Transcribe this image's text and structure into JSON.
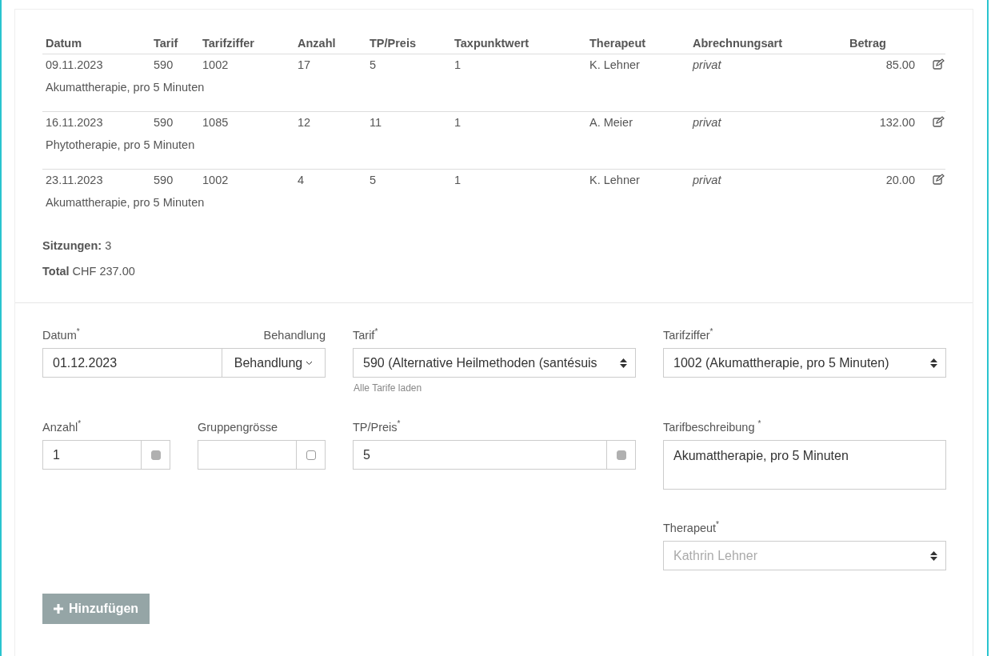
{
  "table": {
    "columns": [
      "Datum",
      "Tarif",
      "Tarifziffer",
      "Anzahl",
      "TP/Preis",
      "Taxpunktwert",
      "Therapeut",
      "Abrechnungsart",
      "Betrag"
    ],
    "rows": [
      {
        "cells": [
          "09.11.2023",
          "590",
          "1002",
          "17",
          "5",
          "1",
          "K. Lehner",
          "privat",
          "85.00"
        ],
        "description": "Akumattherapie, pro 5 Minuten"
      },
      {
        "cells": [
          "16.11.2023",
          "590",
          "1085",
          "12",
          "11",
          "1",
          "A. Meier",
          "privat",
          "132.00"
        ],
        "description": "Phytotherapie, pro 5 Minuten"
      },
      {
        "cells": [
          "23.11.2023",
          "590",
          "1002",
          "4",
          "5",
          "1",
          "K. Lehner",
          "privat",
          "20.00"
        ],
        "description": "Akumattherapie, pro 5 Minuten"
      }
    ]
  },
  "summary": [
    "**Sitzungen:** 3",
    "**Total** CHF 237.00"
  ],
  "form": {
    "datum": {
      "label": "Datum$^{*}$",
      "side_label": "Behandlung",
      "value": "01.12.2023",
      "dropdown": "Behandlung"
    },
    "tarif": {
      "label": "Tarif$^{*}$",
      "value": "590 (Alternative Heilmethoden (santésuis",
      "hint": "Alle Tarife laden"
    },
    "tarifziffer": {
      "label": "Tarifziffer$^{*}$",
      "value": "1002 (Akumattherapie, pro 5 Minuten)"
    },
    "anzahl": {
      "label": "Anzahl$^{*}$",
      "value": "1",
      "checked": true
    },
    "gruppengroesse": {
      "label": "Gruppengrösse",
      "checked": false
    },
    "tp_preis": {
      "label": "TP/Preis$^{*}$",
      "value": "5",
      "checked": true
    },
    "tarifbeschreibung": {
      "label": "Tarifbeschreibung $^{*}$",
      "value": "Akumattherapie, pro 5 Minuten"
    },
    "therapeut": {
      "label": "Therapeut$^{*}$",
      "value": "Kathrin Lehner",
      "disabled": true
    }
  },
  "add_button": {
    "label": "Hinzufügen"
  }
}
